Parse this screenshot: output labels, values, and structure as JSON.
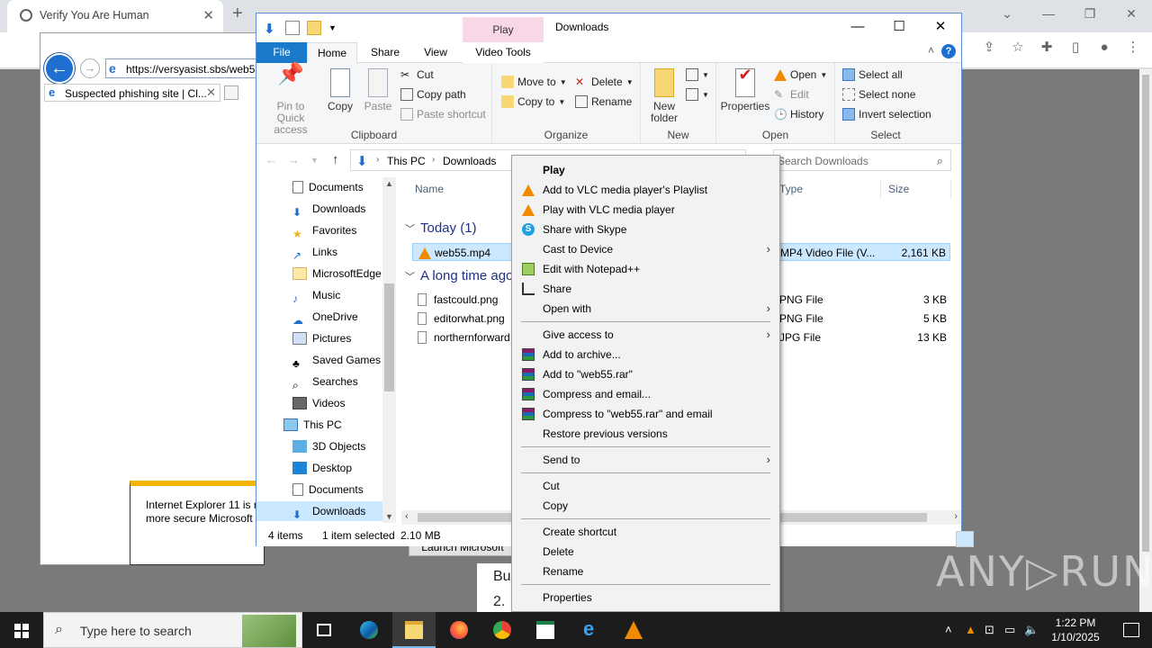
{
  "chrome": {
    "tab_title": "Verify You Are Human",
    "tab_close": "✕",
    "new_tab": "+",
    "win_minimize": "—",
    "win_restore": "❐",
    "win_close": "✕",
    "win_chevron": "⌄"
  },
  "ie": {
    "url": "https://versyasist.sbs/web5",
    "tab_title": "Suspected phishing site | Cl...",
    "notice_line1": "Internet Explorer 11 is r",
    "notice_line2": "more secure Microsoft",
    "launch_button": "Launch Microsoft"
  },
  "page_fragment": {
    "line1": "Bu",
    "line2": "2."
  },
  "watermark": "ANY▷RUN",
  "explorer": {
    "title": "Downloads",
    "play_tab": "Play",
    "ribbon_tabs": {
      "file": "File",
      "home": "Home",
      "share": "Share",
      "view": "View",
      "video_tools": "Video Tools"
    },
    "clipboard": {
      "label": "Clipboard",
      "pin": "Pin to Quick access",
      "copy": "Copy",
      "paste": "Paste",
      "cut": "Cut",
      "copy_path": "Copy path",
      "paste_shortcut": "Paste shortcut"
    },
    "organize": {
      "label": "Organize",
      "move_to": "Move to",
      "copy_to": "Copy to",
      "delete": "Delete",
      "rename": "Rename"
    },
    "new": {
      "label": "New",
      "new_folder": "New folder"
    },
    "open": {
      "label": "Open",
      "properties": "Properties",
      "open": "Open",
      "edit": "Edit",
      "history": "History"
    },
    "select": {
      "label": "Select",
      "select_all": "Select all",
      "select_none": "Select none",
      "invert": "Invert selection"
    },
    "address": {
      "this_pc": "This PC",
      "downloads": "Downloads"
    },
    "search_placeholder": "Search Downloads",
    "nav_items": [
      "Documents",
      "Downloads",
      "Favorites",
      "Links",
      "MicrosoftEdge",
      "Music",
      "OneDrive",
      "Pictures",
      "Saved Games",
      "Searches",
      "Videos",
      "This PC",
      "3D Objects",
      "Desktop",
      "Documents",
      "Downloads"
    ],
    "columns": {
      "name": "Name",
      "type": "Type",
      "size": "Size"
    },
    "group_today": "Today (1)",
    "group_old": "A long time ago",
    "files": [
      {
        "name": "web55.mp4",
        "type": "MP4 Video File (V...",
        "size": "2,161 KB"
      },
      {
        "name": "fastcould.png",
        "type": "PNG File",
        "size": "3 KB"
      },
      {
        "name": "editorwhat.png",
        "type": "PNG File",
        "size": "5 KB"
      },
      {
        "name": "northernforward",
        "type": "JPG File",
        "size": "13 KB"
      }
    ],
    "status": {
      "items": "4 items",
      "selected": "1 item selected",
      "size": "2.10 MB"
    }
  },
  "context_menu": {
    "items": [
      "Play",
      "Add to VLC media player's Playlist",
      "Play with VLC media player",
      "Share with Skype",
      "Cast to Device",
      "Edit with Notepad++",
      "Share",
      "Open with",
      "Give access to",
      "Add to archive...",
      "Add to \"web55.rar\"",
      "Compress and email...",
      "Compress to \"web55.rar\" and email",
      "Restore previous versions",
      "Send to",
      "Cut",
      "Copy",
      "Create shortcut",
      "Delete",
      "Rename",
      "Properties"
    ]
  },
  "taskbar": {
    "search_placeholder": "Type here to search",
    "time": "1:22 PM",
    "date": "1/10/2025"
  },
  "colors": {
    "accent": "#1979ca",
    "selection": "#cce8ff",
    "taskbar": "#1c1c1c",
    "play_tab": "#f8d7e6"
  }
}
